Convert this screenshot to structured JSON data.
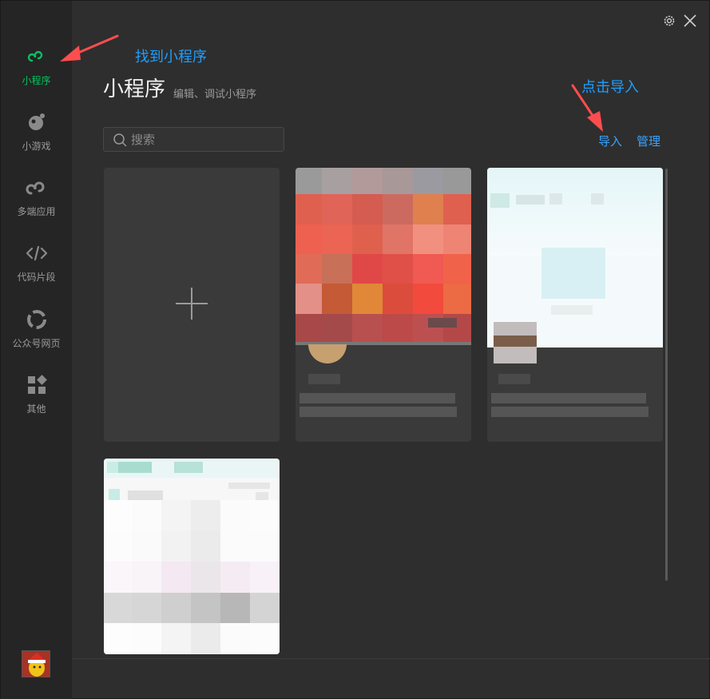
{
  "sidebar": {
    "items": [
      {
        "label": "小程序",
        "icon": "mini-program-icon"
      },
      {
        "label": "小游戏",
        "icon": "mini-game-icon"
      },
      {
        "label": "多端应用",
        "icon": "multi-platform-icon"
      },
      {
        "label": "代码片段",
        "icon": "code-icon"
      },
      {
        "label": "公众号网页",
        "icon": "web-icon"
      },
      {
        "label": "其他",
        "icon": "grid-icon"
      }
    ],
    "active_index": 0
  },
  "header": {
    "title": "小程序",
    "subtitle": "编辑、调试小程序"
  },
  "annotations": {
    "find": "找到小程序",
    "import": "点击导入"
  },
  "search": {
    "placeholder": "搜索",
    "value": ""
  },
  "actions": {
    "import_label": "导入",
    "manage_label": "管理"
  },
  "colors": {
    "accent": "#07c160",
    "link": "#3aa3ff",
    "annotation": "#1e9fff",
    "arrow": "#ff4d4f"
  }
}
